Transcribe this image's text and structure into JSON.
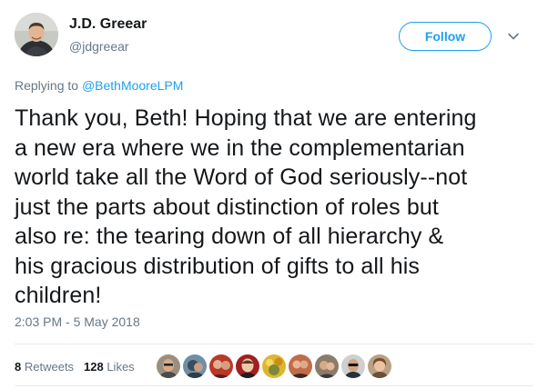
{
  "author": {
    "name": "J.D. Greear",
    "handle": "@jdgreear"
  },
  "follow_label": "Follow",
  "reply": {
    "prefix": "Replying to ",
    "mention": "@BethMooreLPM"
  },
  "tweet_text": "Thank you, Beth! Hoping that we are entering\na new era where we in the complementarian\nworld take all the Word of God seriously--not\njust the parts about distinction of roles but\nalso re: the tearing down of all hierarchy &\nhis gracious distribution of gifts to all his\nchildren!",
  "timestamp": "2:03 PM - 5 May 2018",
  "stats": {
    "retweets_count": "8",
    "retweets_label": "Retweets",
    "likes_count": "128",
    "likes_label": "Likes"
  },
  "colors": {
    "accent": "#1da1f2",
    "secondary_text": "#657786",
    "primary_text": "#14171a",
    "divider": "#e6ecf0"
  }
}
